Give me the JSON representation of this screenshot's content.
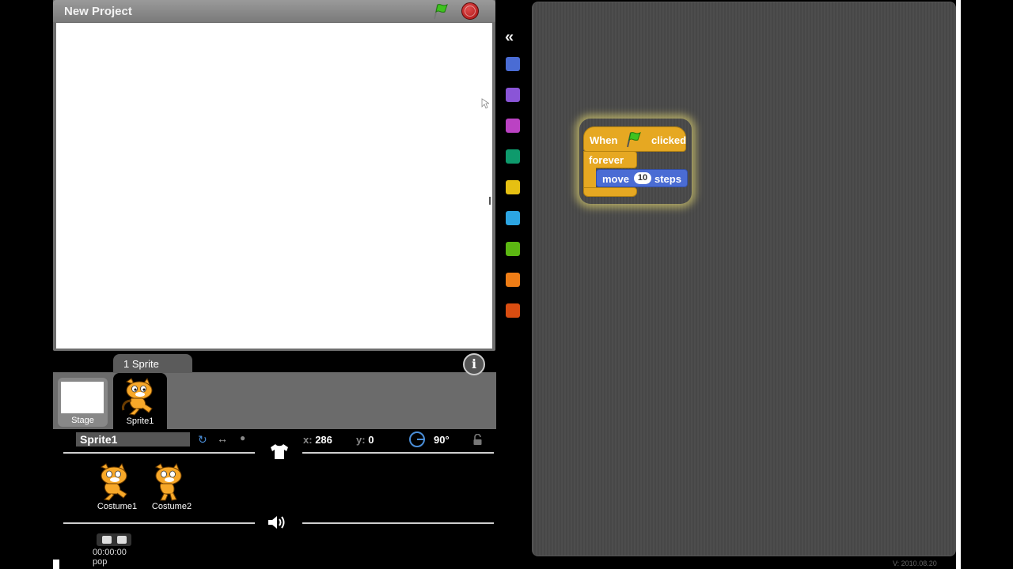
{
  "stage": {
    "project_title": "New Project"
  },
  "sprites": {
    "tab_label": "1 Sprite",
    "stage_label": "Stage",
    "items": [
      {
        "label": "Sprite1"
      }
    ]
  },
  "sprite_info": {
    "name": "Sprite1",
    "x_label": "x:",
    "x_value": "286",
    "y_label": "y:",
    "y_value": "0",
    "direction": "90°"
  },
  "costumes": [
    {
      "label": "Costume1"
    },
    {
      "label": "Costume2"
    }
  ],
  "sound": {
    "time": "00:00:00",
    "name": "pop"
  },
  "palette": {
    "categories": [
      {
        "name": "motion",
        "color": "#4a6cd4"
      },
      {
        "name": "looks",
        "color": "#8a55d7"
      },
      {
        "name": "sound",
        "color": "#bb42c3"
      },
      {
        "name": "pen",
        "color": "#0e9a6c"
      },
      {
        "name": "control",
        "color": "#e6c012"
      },
      {
        "name": "sensing",
        "color": "#2ca5e2"
      },
      {
        "name": "operators",
        "color": "#5cb712"
      },
      {
        "name": "variables",
        "color": "#ee7d16"
      },
      {
        "name": "sensing-alt",
        "color": "#d94d11"
      }
    ]
  },
  "script": {
    "hat_when": "When",
    "hat_clicked": "clicked",
    "forever_label": "forever",
    "move_label": "move",
    "move_value": "10",
    "move_unit": "steps"
  },
  "version": "V: 2010.08.20"
}
